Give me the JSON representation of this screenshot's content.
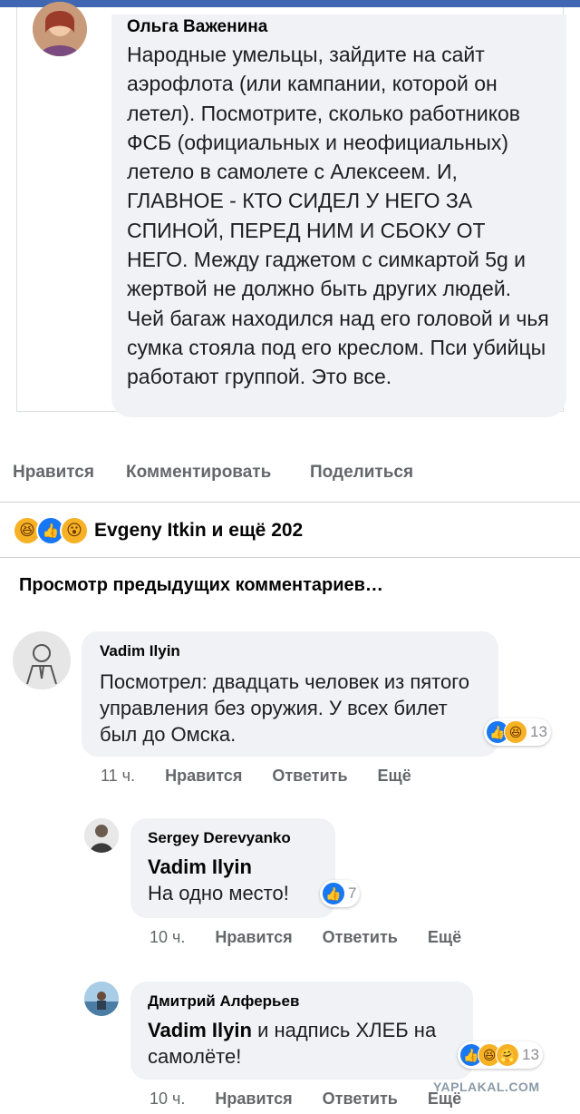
{
  "shared_post": {
    "author": "Ольга Важенина",
    "text": "Народные умельцы, зайдите на сайт аэрофлота (или кампании, которой он летел). Посмотрите, сколько работников ФСБ (официальных и неофициальных) летело в самолете с Алексеем. И, ГЛАВНОЕ - КТО СИДЕЛ У НЕГО ЗА СПИНОЙ, ПЕРЕД НИМ И СБОКУ ОТ НЕГО. Между гаджетом с симкартой 5g и жертвой не должно быть других людей. Чей багаж находился над его головой и чья сумка стояла под его креслом. Пси убийцы работают группой. Это все."
  },
  "post_actions": {
    "like": "Нравится",
    "comment": "Комментировать",
    "share": "Поделиться"
  },
  "reaction_summary": {
    "icons": [
      "haha-reaction-icon",
      "like-reaction-icon",
      "wow-reaction-icon"
    ],
    "text": "Evgeny Itkin и ещё 202"
  },
  "previous_comments_label": "Просмотр предыдущих комментариев…",
  "comments": [
    {
      "author": "Vadim Ilyin",
      "mention": "",
      "text": "Посмотрел: двадцать человек из пятого управления без оружия. У всех билет был до Омска.",
      "reaction_count": "13",
      "time": "11 ч.",
      "like": "Нравится",
      "reply": "Ответить",
      "more": "Ещё"
    },
    {
      "author": "Sergey Derevyanko",
      "mention": "Vadim Ilyin",
      "text": "На одно место!",
      "reaction_count": "7",
      "time": "10 ч.",
      "like": "Нравится",
      "reply": "Ответить",
      "more": "Ещё"
    },
    {
      "author": "Дмитрий Алферьев",
      "mention": "Vadim Ilyin",
      "text": "и надпись ХЛЕБ на самолёте!",
      "reaction_count": "13",
      "time": "10 ч.",
      "like": "Нравится",
      "reply": "Ответить",
      "more": "Ещё"
    }
  ],
  "watermark": "YAPLAKAL.COM",
  "colors": {
    "brand": "#4267b2",
    "bubble": "#f0f2f5",
    "secondary_text": "#65676b",
    "like_blue": "#1877f2",
    "reaction_yellow": "#f7b125"
  }
}
